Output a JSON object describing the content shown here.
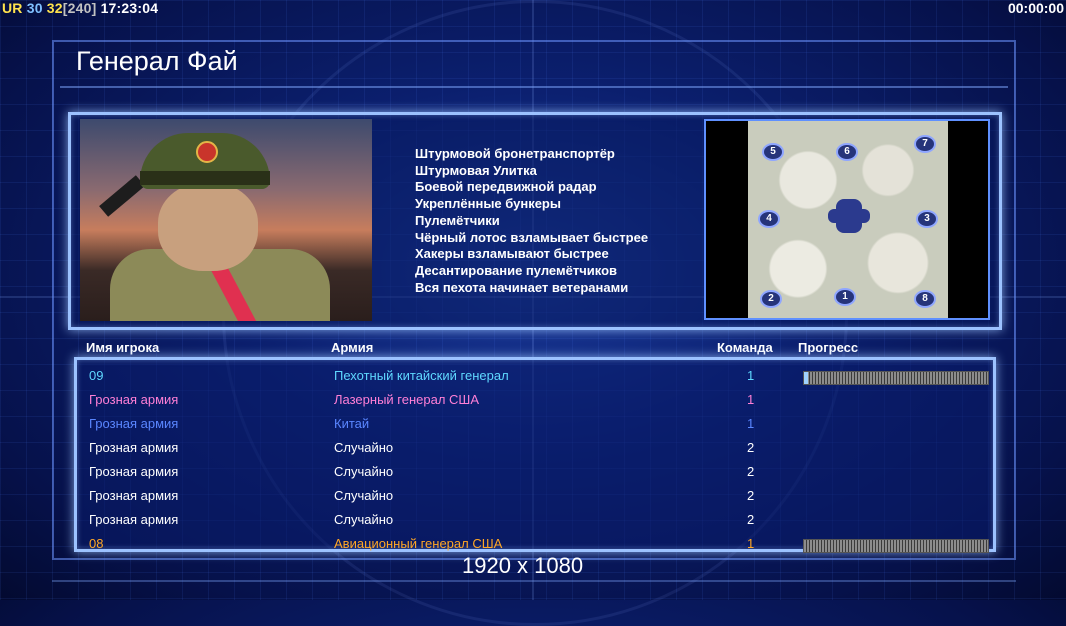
{
  "hud": {
    "ur": "UR",
    "v1": "30",
    "v2": "32",
    "v3": "[240]",
    "time": "17:23:04",
    "timer": "00:00:00"
  },
  "title": "Генерал Фай",
  "perks": [
    "Штурмовой бронетранспортёр",
    "Штурмовая Улитка",
    "Боевой передвижной радар",
    "Укреплённые бункеры",
    "Пулемётчики",
    "Чёрный лотос взламывает быстрее",
    "Хакеры взламывают быстрее",
    "Десантирование пулемётчиков",
    "Вся пехота начинает ветеранами"
  ],
  "map_slots": [
    "5",
    "6",
    "7",
    "4",
    "3",
    "2",
    "1",
    "8"
  ],
  "headers": {
    "player": "Имя игрока",
    "army": "Армия",
    "team": "Команда",
    "progress": "Прогресс"
  },
  "rows": [
    {
      "name": "09",
      "army": "Пехотный китайский генерал",
      "team": "1",
      "color": "#5fd8ff",
      "progress": 0.02
    },
    {
      "name": "Грозная армия",
      "army": "Лазерный генерал США",
      "team": "1",
      "color": "#ff7fd6",
      "progress": null
    },
    {
      "name": "Грозная армия",
      "army": "Китай",
      "team": "1",
      "color": "#5a86ff",
      "progress": null
    },
    {
      "name": "Грозная армия",
      "army": "Случайно",
      "team": "2",
      "color": "#ffffff",
      "progress": null
    },
    {
      "name": "Грозная армия",
      "army": "Случайно",
      "team": "2",
      "color": "#ffffff",
      "progress": null
    },
    {
      "name": "Грозная армия",
      "army": "Случайно",
      "team": "2",
      "color": "#ffffff",
      "progress": null
    },
    {
      "name": "Грозная армия",
      "army": "Случайно",
      "team": "2",
      "color": "#ffffff",
      "progress": null
    },
    {
      "name": "08",
      "army": "Авиационный генерал США",
      "team": "1",
      "color": "#ffa726",
      "progress": 0.0
    }
  ],
  "resolution": "1920 x 1080"
}
